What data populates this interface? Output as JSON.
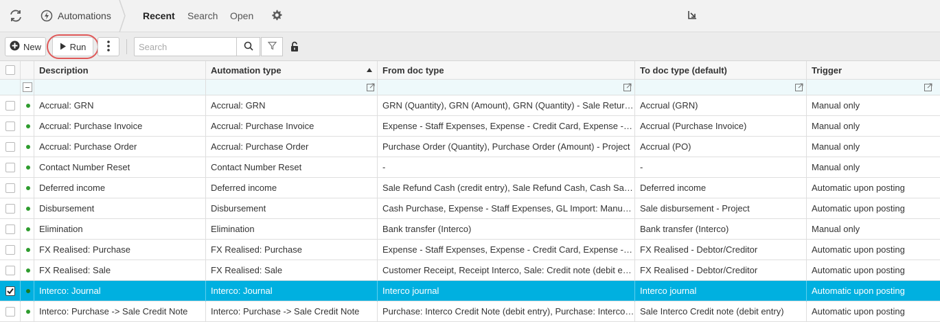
{
  "topnav": {
    "app_title": "Automations",
    "tabs": [
      {
        "label": "Recent",
        "active": true
      },
      {
        "label": "Search",
        "active": false
      },
      {
        "label": "Open",
        "active": false
      }
    ]
  },
  "toolbar": {
    "new_label": "New",
    "run_label": "Run",
    "search_placeholder": "Search"
  },
  "grid": {
    "columns": [
      "Description",
      "Automation type",
      "From doc type",
      "To doc type (default)",
      "Trigger"
    ],
    "sorted_column": "Automation type",
    "sort_direction": "ascending",
    "rows": [
      {
        "description": "Accrual: GRN",
        "type": "Accrual: GRN",
        "from": "GRN (Quantity), GRN (Amount), GRN (Quantity) - Sale Return Cash, GRN",
        "to": "Accrual (GRN)",
        "trigger": "Manual only",
        "selected": false
      },
      {
        "description": "Accrual: Purchase Invoice",
        "type": "Accrual: Purchase Invoice",
        "from": "Expense - Staff Expenses, Expense - Credit Card, Expense - Other",
        "to": "Accrual (Purchase Invoice)",
        "trigger": "Manual only",
        "selected": false
      },
      {
        "description": "Accrual: Purchase Order",
        "type": "Accrual: Purchase Order",
        "from": "Purchase Order (Quantity), Purchase Order (Amount) - Project",
        "to": "Accrual (PO)",
        "trigger": "Manual only",
        "selected": false
      },
      {
        "description": "Contact Number Reset",
        "type": "Contact Number Reset",
        "from": "-",
        "to": "-",
        "trigger": "Manual only",
        "selected": false
      },
      {
        "description": "Deferred income",
        "type": "Deferred income",
        "from": "Sale Refund Cash (credit entry), Sale Refund Cash, Cash Sale (debit entry)",
        "to": "Deferred income",
        "trigger": "Automatic upon posting",
        "selected": false
      },
      {
        "description": "Disbursement",
        "type": "Disbursement",
        "from": "Cash Purchase, Expense - Staff Expenses, GL Import: Manual Journal",
        "to": "Sale disbursement - Project",
        "trigger": "Automatic upon posting",
        "selected": false
      },
      {
        "description": "Elimination",
        "type": "Elimination",
        "from": "Bank transfer (Interco)",
        "to": "Bank transfer (Interco)",
        "trigger": "Manual only",
        "selected": false
      },
      {
        "description": "FX Realised: Purchase",
        "type": "FX Realised: Purchase",
        "from": "Expense - Staff Expenses, Expense - Credit Card, Expense - Other",
        "to": "FX Realised - Debtor/Creditor",
        "trigger": "Automatic upon posting",
        "selected": false
      },
      {
        "description": "FX Realised: Sale",
        "type": "FX Realised: Sale",
        "from": "Customer Receipt, Receipt Interco, Sale: Credit note (debit entry)",
        "to": "FX Realised - Debtor/Creditor",
        "trigger": "Automatic upon posting",
        "selected": false
      },
      {
        "description": "Interco: Journal",
        "type": "Interco: Journal",
        "from": "Interco journal",
        "to": "Interco journal",
        "trigger": "Automatic upon posting",
        "selected": true
      },
      {
        "description": "Interco: Purchase -> Sale Credit Note",
        "type": "Interco: Purchase -> Sale Credit Note",
        "from": "Purchase: Interco Credit Note (debit entry), Purchase: Interco Credit Note",
        "to": "Sale Interco Credit note (debit entry)",
        "trigger": "Automatic upon posting",
        "selected": false
      }
    ]
  },
  "colors": {
    "selected_row": "#00b0e0",
    "status_dot": "#2e9c2e",
    "run_highlight": "#e05757"
  }
}
